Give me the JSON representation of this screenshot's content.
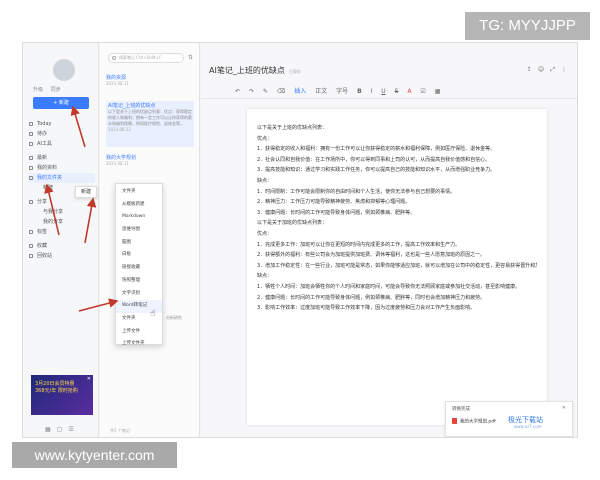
{
  "watermarks": {
    "top": "TG: MYYJJPP",
    "bottom": "www.kytyenter.com"
  },
  "sidebar": {
    "user_actions": [
      "升级",
      "同步"
    ],
    "new_button": "+ 新建",
    "items": [
      {
        "label": "Today"
      },
      {
        "label": "待办"
      },
      {
        "label": "AI工具"
      },
      {
        "label": "最新"
      },
      {
        "label": "我的资料"
      },
      {
        "label": "我的文件夹"
      },
      {
        "label": "新建"
      },
      {
        "label": "分享"
      },
      {
        "label": "与我分享"
      },
      {
        "label": "我的分享"
      },
      {
        "label": "标签"
      },
      {
        "label": "收藏"
      },
      {
        "label": "回收站"
      }
    ],
    "ad": {
      "line1": "3月20日会员特惠",
      "line2": "368元/年 限时抢购"
    }
  },
  "note_list": {
    "search_placeholder": "搜索笔记 Ctrl+Shift+F",
    "notes": [
      {
        "title": "我的资源",
        "date": "2023.08.11"
      },
      {
        "title": "AI笔记_上班的优缺点",
        "snippet": "以下是关于上班的优缺点列表：优点：获得稳定的收入和福利；拥有一定工作可以让你获得的薪水和福利保障，例如医疗保险、退休金等。",
        "date": "2023.08.22"
      },
      {
        "title": "我的大学规划",
        "date": "2023.08.11"
      },
      {
        "title": "分析研究",
        "snippet": "分析研究..."
      }
    ],
    "count": "共5 个笔记"
  },
  "context_menu_small": {
    "label": "新建"
  },
  "context_menu": {
    "items": [
      "文件夹",
      "从模板新建",
      "Markdown",
      "思维导图",
      "脑图",
      "白板",
      "链接收藏",
      "快照整理",
      "文字识别",
      "Word转笔记",
      "文件夹",
      "上传文件",
      "上传文件夹"
    ],
    "highlighted_index": 9
  },
  "editor": {
    "title": "AI笔记_上班的优缺点",
    "saved": "已保存",
    "top_icons": [
      "share",
      "users",
      "expand",
      "more"
    ],
    "toolbar": [
      "撤销",
      "重做",
      "格式刷",
      "清除格式",
      "插入",
      "正文",
      "字号",
      "B",
      "I",
      "U",
      "S",
      "A",
      "清单",
      "表格"
    ],
    "toolbar_insert": "插入",
    "body": [
      "以下是关于上班的优缺点列表：",
      "优点：",
      "1．获得稳定的收入和福利：拥有一份工作可以让你获得稳定的薪水和福利保障，例如医疗保险、退休金等。",
      "2．社会认同和自我价值：在工作场所中，你可以得到同事和上司的认可，从而提高自我价值感和自信心。",
      "3．提高技能和知识：通过学习和实践工作任务，你可以提高自己的技能和知识水平，从而增强职业竞争力。",
      "缺点：",
      "1．时间限制：工作可能会限制你的自由时间和个人生活，使你无法参与自己想要的事情。",
      "2．精神压力：工作压力可能导致精神疲劳、焦虑和抑郁等心理问题。",
      "3．健康问题：长时间的工作可能导致身体问题，例如颈椎病、肥胖等。",
      "以下是关于加班的优缺点列表：",
      "优点：",
      "1．完成更多工作：加班可以让你在更短的时间内完成更多的工作，提高工作效率和生产力。",
      "2．获得额外的福利：有些公司会为加班提供加班费、调休等福利，这也是一些人愿意加班的原因之一。",
      "3．增加工作稳定性：在一些行业，加班可能是常态，如果你能够适应加班，就可以增加在公司中的稳定性，更容易获得晋升和加薪的机会。",
      "缺点：",
      "1．牺牲个人时间：加班会牺牲你的个人时间和家庭时间，可能会导致你无法照顾家庭或参加社交活动，甚至影响健康。",
      "2．健康问题：长时间的工作可能导致身体问题，例如颈椎病、肥胖等，同时也会增加精神压力和疲劳。",
      "3．影响工作效率：过度加班可能导致工作效率下降，因为过度疲劳和压力会对工作产生负面影响。"
    ]
  },
  "download_panel": {
    "header": "转换完成",
    "file": "我的大学规划.pdf"
  },
  "brand": {
    "name": "极光下载站",
    "sub": "www.xz7.com"
  }
}
